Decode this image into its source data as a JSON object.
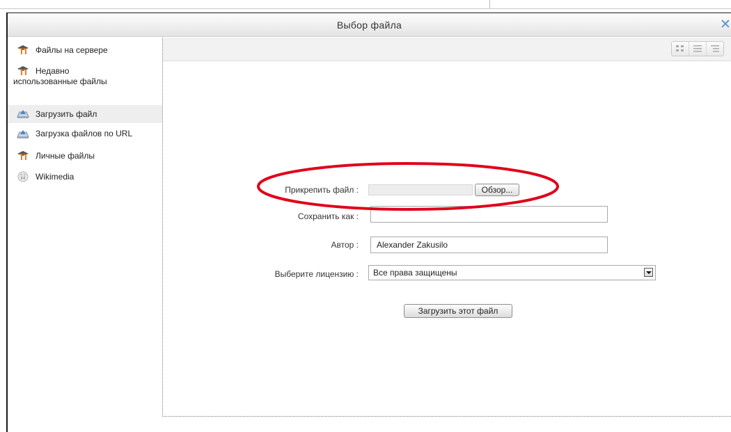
{
  "dialog": {
    "title": "Выбор файла",
    "close_icon": "close-icon"
  },
  "sidebar": {
    "items": [
      {
        "label": "Файлы на сервере",
        "icon": "moodle-icon"
      },
      {
        "label_line1": "Недавно",
        "label_line2": "использованные файлы",
        "icon": "moodle-icon"
      },
      {
        "label": "Загрузить файл",
        "icon": "upload-icon",
        "selected": true
      },
      {
        "label": "Загрузка файлов по URL",
        "icon": "upload-icon"
      },
      {
        "label": "Личные файлы",
        "icon": "moodle-icon"
      },
      {
        "label": "Wikimedia",
        "icon": "wikimedia-icon"
      }
    ]
  },
  "toolbar": {
    "view_icons": [
      "icon-view-icon",
      "list-view-icon",
      "tree-view-icon"
    ]
  },
  "form": {
    "attach_label": "Прикрепить файл :",
    "browse_label": "Обзор...",
    "save_as_label": "Сохранить как :",
    "save_as_value": "",
    "author_label": "Автор :",
    "author_value": "Alexander Zakusilo",
    "license_label": "Выберите лицензию :",
    "license_value": "Все права защищены",
    "submit_label": "Загрузить этот файл"
  },
  "colors": {
    "annotation": "#e0001b",
    "close": "#5a8fd0",
    "moodle_orange": "#f47a20"
  }
}
